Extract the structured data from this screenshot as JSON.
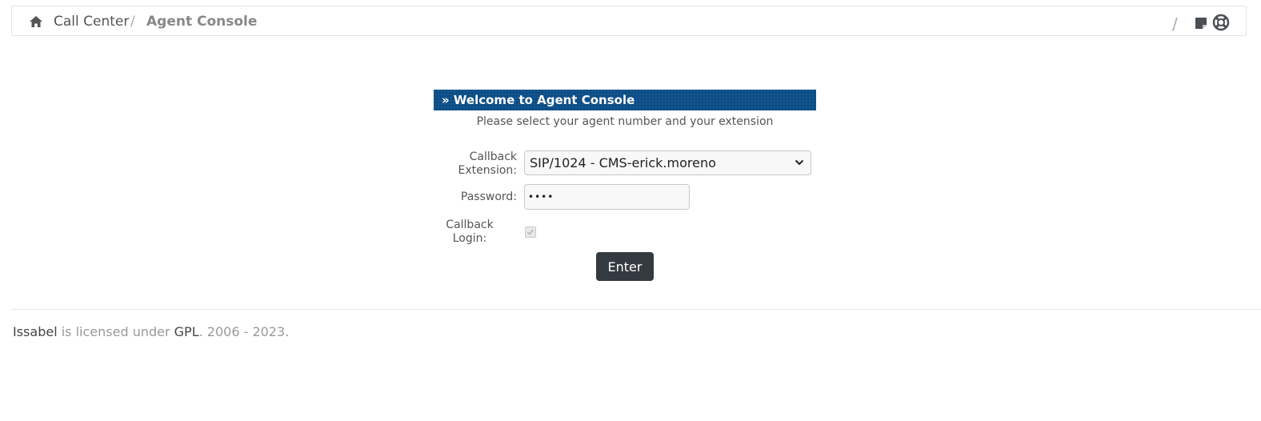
{
  "breadcrumb": {
    "root": "Call Center",
    "separator": "/",
    "current": "Agent Console"
  },
  "toolbar": {
    "separator": "/",
    "icons": [
      "sticky-note-icon",
      "help-lifebuoy-icon"
    ]
  },
  "panel": {
    "title": "» Welcome to Agent Console",
    "subtitle": "Please select your agent number and your extension",
    "title_color": "#0b4d86"
  },
  "form": {
    "extension_label_line1": "Callback",
    "extension_label_line2": "Extension:",
    "extension_value": "SIP/1024 - CMS-erick.moreno",
    "password_label": "Password:",
    "password_value": "••••",
    "callback_login_label_line1": "Callback",
    "callback_login_label_line2": "Login:",
    "callback_login_checked": true,
    "enter_label": "Enter",
    "button_color": "#343a40"
  },
  "footer": {
    "brand": "Issabel",
    "text1": " is licensed under ",
    "license": "GPL",
    "text2": ". 2006 - 2023."
  }
}
